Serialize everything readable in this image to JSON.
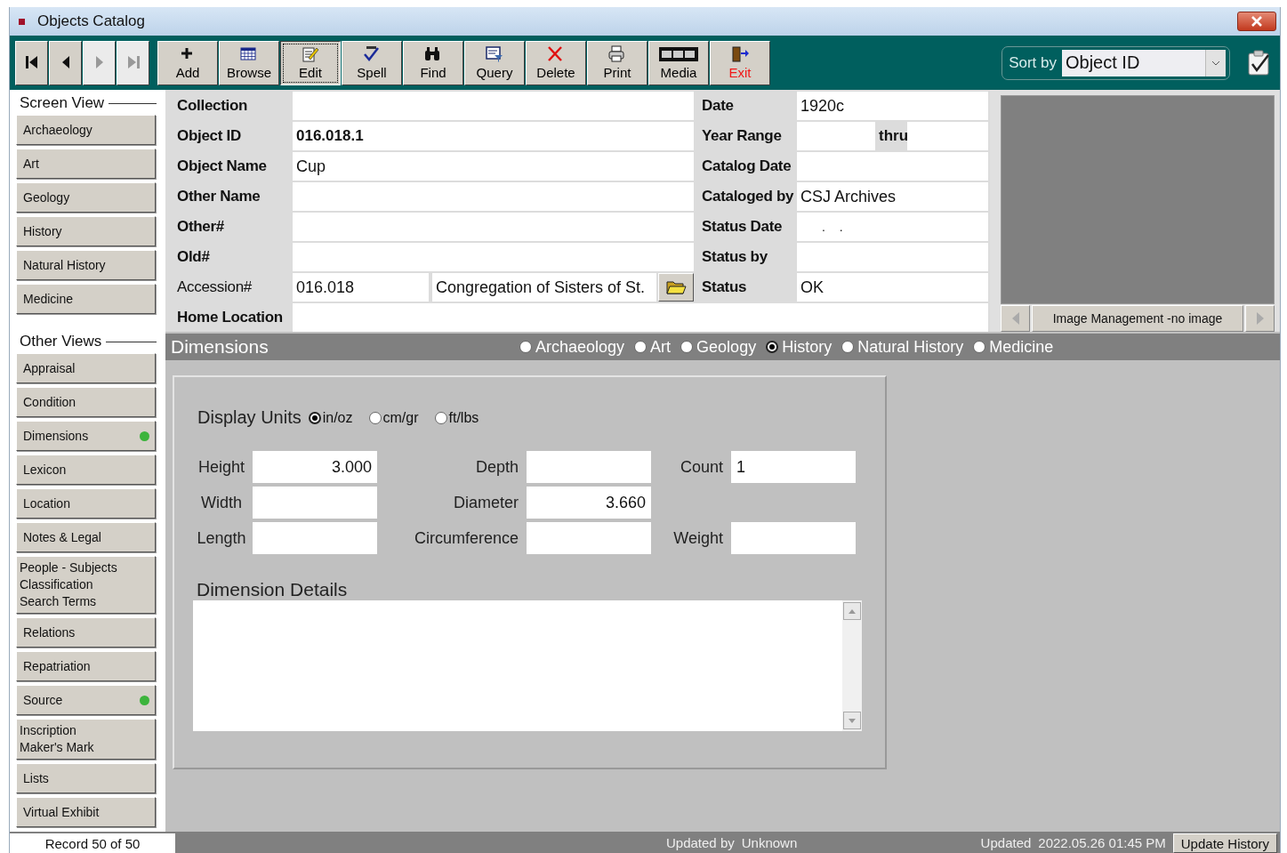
{
  "window": {
    "title": "Objects Catalog"
  },
  "toolbar": {
    "nav": [
      {
        "kind": "first",
        "disabled": false
      },
      {
        "kind": "prev",
        "disabled": false
      },
      {
        "kind": "next",
        "disabled": true
      },
      {
        "kind": "last",
        "disabled": true
      }
    ],
    "buttons": [
      {
        "kind": "add",
        "label": "Add",
        "selected": false
      },
      {
        "kind": "browse",
        "label": "Browse",
        "selected": false
      },
      {
        "kind": "edit",
        "label": "Edit",
        "selected": true
      },
      {
        "kind": "spell",
        "label": "Spell",
        "selected": false
      },
      {
        "kind": "find",
        "label": "Find",
        "selected": false
      },
      {
        "kind": "query",
        "label": "Query",
        "selected": false
      },
      {
        "kind": "delete",
        "label": "Delete",
        "selected": false
      },
      {
        "kind": "print",
        "label": "Print",
        "selected": false
      },
      {
        "kind": "media",
        "label": "Media",
        "selected": false
      },
      {
        "kind": "exit",
        "label": "Exit",
        "selected": false
      }
    ],
    "sort": {
      "label": "Sort by",
      "value": "Object ID"
    }
  },
  "sidebar": {
    "sections": [
      {
        "heading": "Screen View",
        "items": [
          {
            "label": "Archaeology",
            "indicator": false
          },
          {
            "label": "Art",
            "indicator": false
          },
          {
            "label": "Geology",
            "indicator": false
          },
          {
            "label": "History",
            "indicator": false
          },
          {
            "label": "Natural History",
            "indicator": false
          },
          {
            "label": "Medicine",
            "indicator": false
          }
        ]
      },
      {
        "heading": "Other Views",
        "items": [
          {
            "label": "Appraisal",
            "indicator": false
          },
          {
            "label": "Condition",
            "indicator": false
          },
          {
            "label": "Dimensions",
            "indicator": true
          },
          {
            "label": "Lexicon",
            "indicator": false
          },
          {
            "label": "Location",
            "indicator": false
          },
          {
            "label": "Notes & Legal",
            "indicator": false
          },
          {
            "label": "People - Subjects\nClassification\nSearch Terms",
            "indicator": false
          },
          {
            "label": "Relations",
            "indicator": false
          },
          {
            "label": "Repatriation",
            "indicator": false
          },
          {
            "label": "Source",
            "indicator": true
          },
          {
            "label": "Inscription\nMaker's Mark",
            "indicator": false
          },
          {
            "label": "Lists",
            "indicator": false
          },
          {
            "label": "Virtual Exhibit",
            "indicator": false
          }
        ]
      }
    ]
  },
  "record": {
    "left": [
      {
        "label": "Collection",
        "label_bold": true
      },
      {
        "label": "Object ID",
        "label_bold": true,
        "value": "016.018.1",
        "value_bold": true
      },
      {
        "label": "Object Name",
        "label_bold": true,
        "value": "Cup",
        "value_bold": false
      },
      {
        "label": "Other Name",
        "label_bold": true
      },
      {
        "label": "Other#",
        "label_bold": true
      },
      {
        "label": "Old#",
        "label_bold": true
      },
      {
        "label": "Accession#",
        "label_bold": false,
        "kind": "accession",
        "value": "016.018",
        "value2": "Congregation of Sisters of St."
      }
    ],
    "right": [
      {
        "label": "Date",
        "value": "1920c"
      },
      {
        "label": "Year Range",
        "kind": "range",
        "separator": "thru"
      },
      {
        "label": "Catalog Date"
      },
      {
        "label": "Cataloged by",
        "value": "CSJ Archives"
      },
      {
        "label": "Status Date",
        "value": ". ."
      },
      {
        "label": "Status by"
      },
      {
        "label": "Status",
        "value": "OK"
      }
    ],
    "home_location": {
      "label": "Home Location"
    }
  },
  "image_panel": {
    "caption": "Image Management -no image"
  },
  "dimensions": {
    "title": "Dimensions",
    "views": [
      {
        "label": "Archaeology",
        "selected": false
      },
      {
        "label": "Art",
        "selected": false
      },
      {
        "label": "Geology",
        "selected": false
      },
      {
        "label": "History",
        "selected": true
      },
      {
        "label": "Natural History",
        "selected": false
      },
      {
        "label": "Medicine",
        "selected": false
      }
    ],
    "units_label": "Display Units",
    "units": [
      {
        "label": "in/oz",
        "selected": true
      },
      {
        "label": "cm/gr",
        "selected": false
      },
      {
        "label": "ft/lbs",
        "selected": false
      }
    ],
    "measure_rows": [
      [
        {
          "label": "Height",
          "value": "3.000"
        },
        {
          "label": "Depth"
        },
        {
          "label": "Count",
          "value": "1"
        }
      ],
      [
        {
          "label": "Width"
        },
        {
          "label": "Diameter",
          "value": "3.660"
        }
      ],
      [
        {
          "label": "Length"
        },
        {
          "label": "Circumference"
        },
        {
          "label": "Weight"
        }
      ]
    ],
    "details_label": "Dimension Details"
  },
  "status_bar": {
    "record": "Record 50 of 50",
    "updated_by_label": "Updated by",
    "updated_by": "Unknown",
    "updated_label": "Updated",
    "updated": "2022.05.26 01:45 PM",
    "history_button": "Update History"
  }
}
